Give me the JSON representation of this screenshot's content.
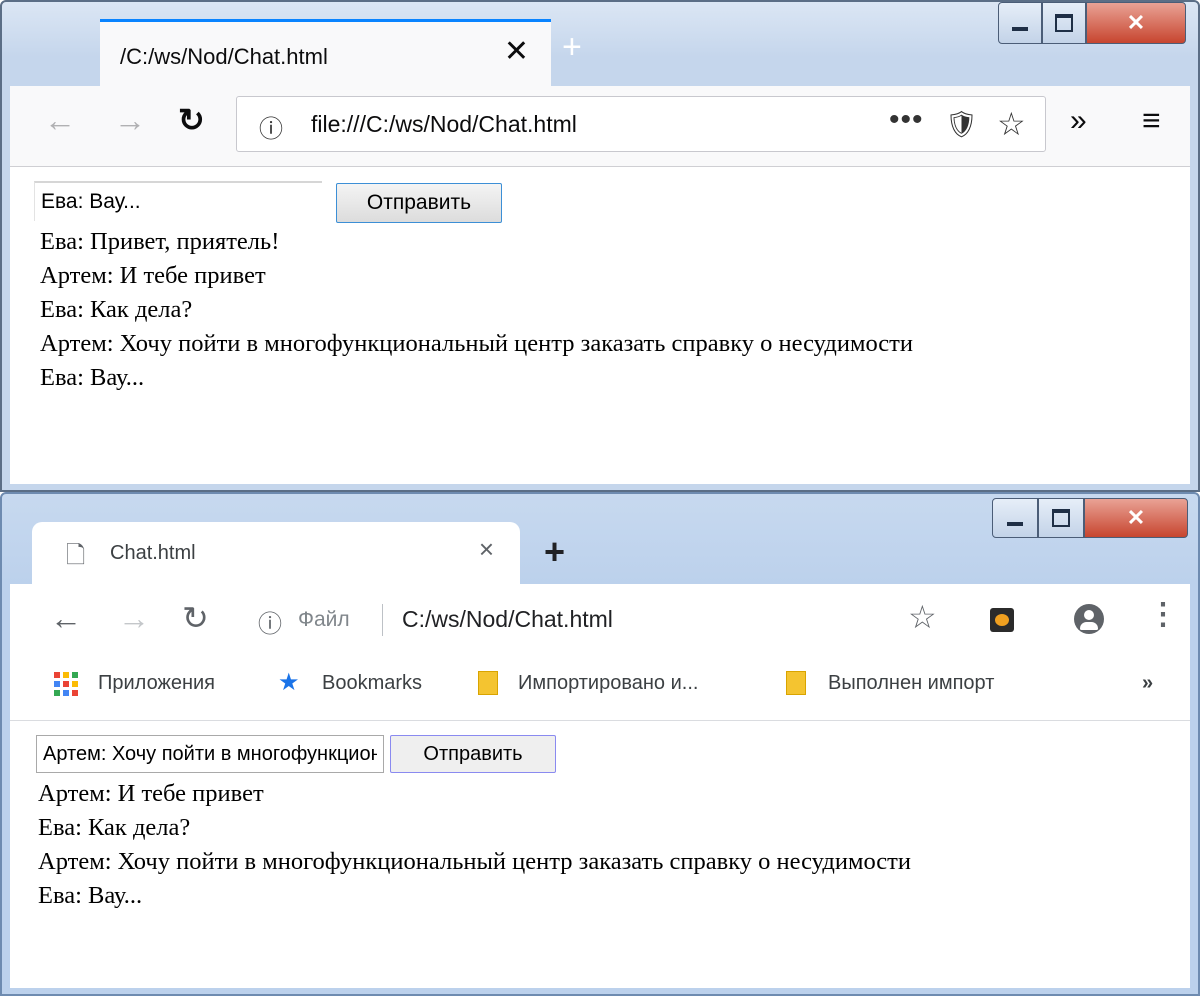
{
  "firefox": {
    "tab_title": "/C:/ws/Nod/Chat.html",
    "tab_close": "✕",
    "new_tab": "+",
    "url": "file:///C:/ws/Nod/Chat.html",
    "url_more": "•••",
    "chat_input_value": "Ева: Вау...",
    "send_label": "Отправить",
    "messages": [
      "Ева: Привет, приятель!",
      "Артем: И тебе привет",
      "Ева: Как дела?",
      "Артем: Хочу пойти в многофункциональный центр заказать справку о несудимости",
      "Ева: Вау..."
    ],
    "icons": {
      "back": "back-arrow-icon",
      "forward": "forward-arrow-icon",
      "reload": "reload-icon",
      "info": "info-icon",
      "pocket": "pocket-icon",
      "bookmark": "star-icon",
      "overflow": "double-chevron-icon",
      "menu": "hamburger-menu-icon"
    },
    "accent": "#0a84ff"
  },
  "chrome": {
    "tab_title": "Chat.html",
    "tab_close": "×",
    "new_tab": "+",
    "url_label": "Файл",
    "url": "C:/ws/Nod/Chat.html",
    "bookmarks": [
      {
        "label": "Приложения",
        "icon": "apps-grid-icon"
      },
      {
        "label": "Bookmarks",
        "icon": "star-icon"
      },
      {
        "label": "Импортировано и...",
        "icon": "folder-icon"
      },
      {
        "label": "Выполнен импорт",
        "icon": "folder-icon"
      }
    ],
    "bookmarks_overflow": "»",
    "chat_input_value": "Артем: Хочу пойти в многофункциональный центр заказать справку о несудимости",
    "send_label": "Отправить",
    "messages": [
      "Артем: И тебе привет",
      "Ева: Как дела?",
      "Артем: Хочу пойти в многофункциональный центр заказать справку о несудимости",
      "Ева: Вау..."
    ]
  }
}
